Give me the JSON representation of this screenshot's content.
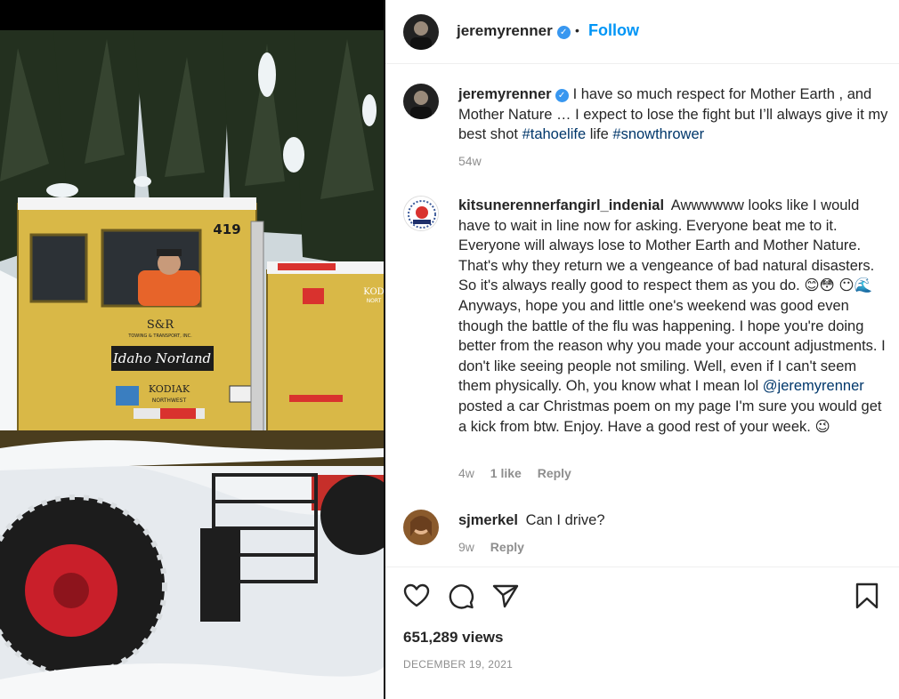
{
  "post": {
    "username": "jeremyrenner",
    "follow_label": "Follow",
    "separator": "•",
    "views": "651,289 views",
    "date": "DECEMBER 19, 2021"
  },
  "media": {
    "truck_number": "419",
    "logo_top": "S&R",
    "logo_sub": "TOWING & TRANSPORT, INC.",
    "sign_name": "Idaho Norland",
    "logo_kodiak": "KODIAK",
    "logo_kodiak_sub": "NORTHWEST",
    "logo_kodiak_right": "KOD",
    "logo_kodiak_right_sub": "NORT"
  },
  "caption": {
    "username": "jeremyrenner",
    "text": "I have so much respect for Mother Earth , and Mother Nature … I expect to lose the fight but I’ll always give it my best shot",
    "tag1": "#tahoelife",
    "mid": "life",
    "tag2": "#snowthrower",
    "time": "54w"
  },
  "comments": [
    {
      "username": "kitsunerennerfangirl_indenial",
      "text_part1": "Awwwwww looks like I would have to wait in line now for asking. Everyone beat me to it. Everyone will always lose to Mother Earth and Mother Nature. That's why they return we a vengeance of bad natural disasters. So it's always really good to respect them as you do. 😊😳 😶🌊 Anyways, hope you and little one's weekend was good even though the battle of the flu was happening. I hope you're doing better from the reason why you made your account adjustments. I don't like seeing people not smiling. Well, even if I can't seem them physically. Oh, you know what I mean lol",
      "mention": "@jeremyrenner",
      "text_part2": "posted a car Christmas poem on my page I'm sure you would get a kick from btw. Enjoy. Have a good rest of your week. 😉",
      "time": "4w",
      "likes": "1 like",
      "reply": "Reply"
    },
    {
      "username": "sjmerkel",
      "text": "Can I drive?",
      "time": "9w",
      "reply": "Reply"
    }
  ],
  "icons": {
    "like": "heart-icon",
    "comment": "comment-icon",
    "share": "share-icon",
    "save": "bookmark-icon"
  }
}
